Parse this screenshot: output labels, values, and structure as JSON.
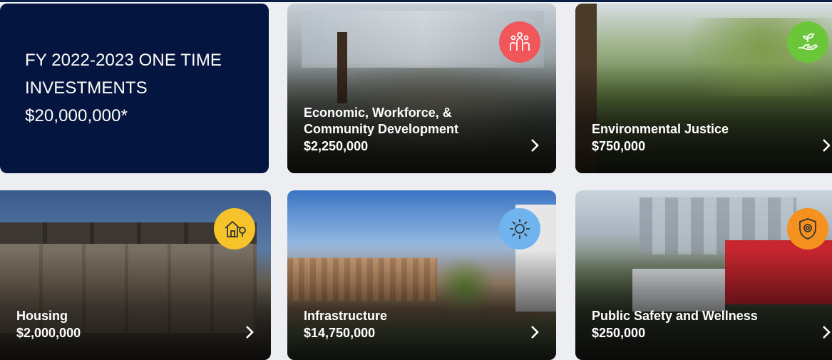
{
  "intro": {
    "line1": "FY 2022-2023 ONE TIME",
    "line2": "INVESTMENTS",
    "line3": "$20,000,000*"
  },
  "cards": [
    {
      "title_line1": "Economic, Workforce, &",
      "title_line2": "Community Development",
      "amount": "$2,250,000",
      "icon": "people-group-icon",
      "badge_color": "#f0565a"
    },
    {
      "title_line1": "Environmental Justice",
      "amount": "$750,000",
      "icon": "hand-seedling-icon",
      "badge_color": "#6cc63a"
    },
    {
      "title_line1": "Housing",
      "amount": "$2,000,000",
      "icon": "house-tree-icon",
      "badge_color": "#f6c42a"
    },
    {
      "title_line1": "Infrastructure",
      "amount": "$14,750,000",
      "icon": "gear-icon",
      "badge_color": "#6fb3ef"
    },
    {
      "title_line1": "Public Safety and Wellness",
      "amount": "$250,000",
      "icon": "badge-shield-icon",
      "badge_color": "#f5911e"
    }
  ]
}
